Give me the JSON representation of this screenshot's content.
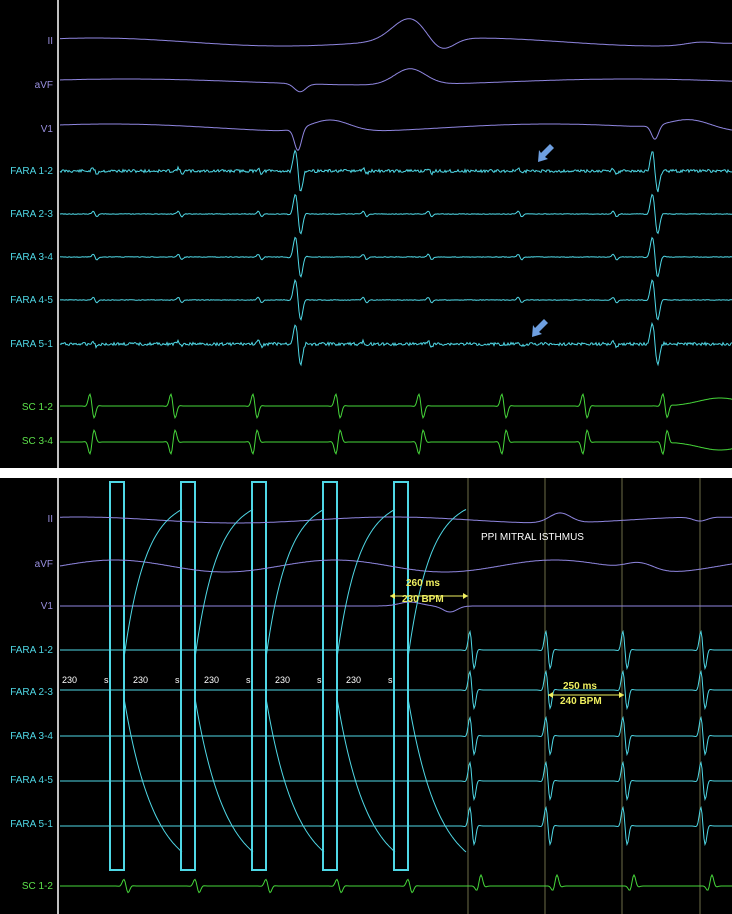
{
  "colors": {
    "background": "#000000",
    "surface_lead": "#8f86e0",
    "catheter_fara": "#4fd8e6",
    "catheter_cs": "#46d63a",
    "annotation_yellow": "#f0f060",
    "arrow_blue": "#6e9fe0",
    "separator": "#ffffff"
  },
  "top_panel": {
    "channels": [
      {
        "name": "II",
        "color": "purple"
      },
      {
        "name": "aVF",
        "color": "purple"
      },
      {
        "name": "V1",
        "color": "purple"
      },
      {
        "name": "FARA 1-2",
        "color": "cyan"
      },
      {
        "name": "FARA 2-3",
        "color": "cyan"
      },
      {
        "name": "FARA 3-4",
        "color": "cyan"
      },
      {
        "name": "FARA 4-5",
        "color": "cyan"
      },
      {
        "name": "FARA 5-1",
        "color": "cyan"
      },
      {
        "name": "SC 1-2",
        "color": "green"
      },
      {
        "name": "SC 3-4",
        "color": "green"
      }
    ],
    "markers": [
      "arrow-icon",
      "arrow-icon"
    ]
  },
  "bottom_panel": {
    "channels": [
      {
        "name": "II",
        "color": "purple"
      },
      {
        "name": "aVF",
        "color": "purple"
      },
      {
        "name": "V1",
        "color": "purple"
      },
      {
        "name": "FARA 1-2",
        "color": "cyan"
      },
      {
        "name": "FARA 2-3",
        "color": "cyan"
      },
      {
        "name": "FARA 3-4",
        "color": "cyan"
      },
      {
        "name": "FARA 4-5",
        "color": "cyan"
      },
      {
        "name": "FARA 5-1",
        "color": "cyan"
      },
      {
        "name": "SC 1-2",
        "color": "green"
      }
    ],
    "title": "PPI MITRAL ISTHMUS",
    "pacing_cycle_labels": [
      "230",
      "230",
      "230",
      "230",
      "230"
    ],
    "stim_labels": [
      "s",
      "s",
      "s",
      "s",
      "s"
    ],
    "measurement_1": {
      "ms": "260 ms",
      "bpm": "230 BPM"
    },
    "measurement_2": {
      "ms": "250 ms",
      "bpm": "240 BPM"
    }
  }
}
